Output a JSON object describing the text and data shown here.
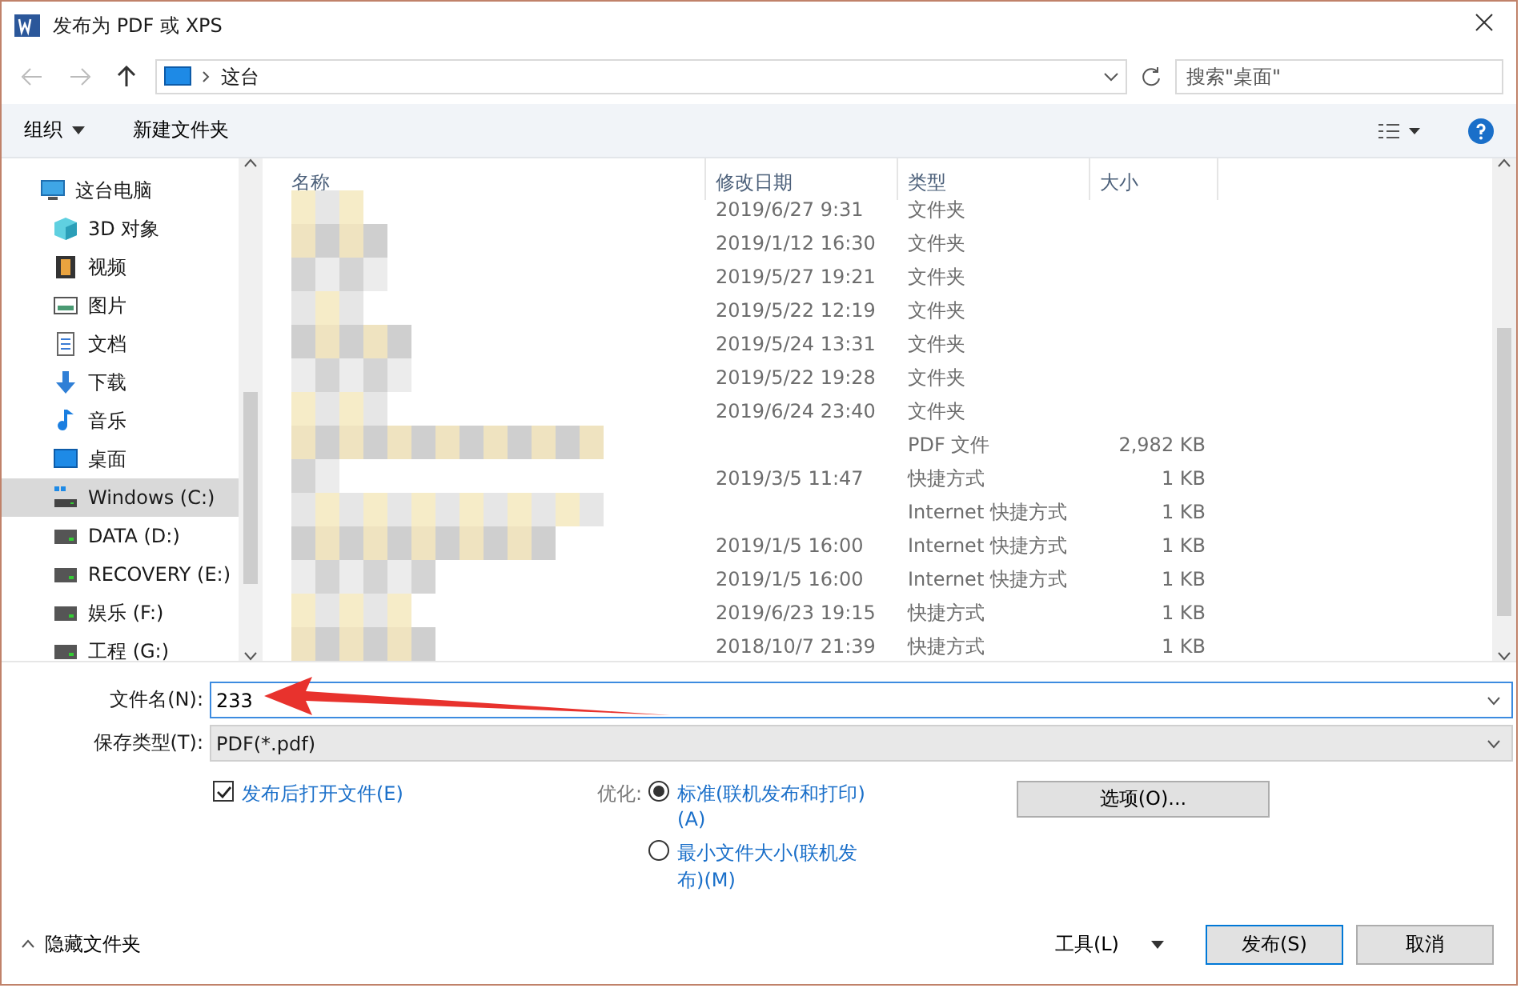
{
  "window": {
    "title": "发布为 PDF 或 XPS"
  },
  "address": {
    "crumbs": [
      "这台"
    ]
  },
  "search": {
    "placeholder": "搜索\"桌面\""
  },
  "toolbar": {
    "organize": "组织",
    "new_folder": "新建文件夹"
  },
  "sidebar": {
    "items": [
      {
        "label": "这台电脑",
        "kind": "pc",
        "selected": false,
        "children": [
          {
            "label": "3D 对象",
            "kind": "cube",
            "selected": false
          },
          {
            "label": "视频",
            "kind": "film",
            "selected": false
          },
          {
            "label": "图片",
            "kind": "image",
            "selected": false
          },
          {
            "label": "文档",
            "kind": "doc",
            "selected": false
          },
          {
            "label": "下载",
            "kind": "download",
            "selected": false
          },
          {
            "label": "音乐",
            "kind": "music",
            "selected": false
          },
          {
            "label": "桌面",
            "kind": "desktop",
            "selected": false
          },
          {
            "label": "Windows (C:)",
            "kind": "sysdrive",
            "selected": true
          },
          {
            "label": "DATA (D:)",
            "kind": "drive",
            "selected": false
          },
          {
            "label": "RECOVERY (E:)",
            "kind": "drive",
            "selected": false
          },
          {
            "label": "娱乐 (F:)",
            "kind": "drive",
            "selected": false
          },
          {
            "label": "工程 (G:)",
            "kind": "drive",
            "selected": false
          }
        ]
      }
    ]
  },
  "table": {
    "columns": [
      "名称",
      "修改日期",
      "类型",
      "大小"
    ],
    "rows": [
      {
        "date": "2019/6/27 9:31",
        "type": "文件夹"
      },
      {
        "date": "2019/1/12 16:30",
        "type": "文件夹"
      },
      {
        "date": "2019/5/27 19:21",
        "type": "文件夹"
      },
      {
        "date": "2019/5/22 12:19",
        "type": "文件夹"
      },
      {
        "date": "2019/5/24 13:31",
        "type": "文件夹"
      },
      {
        "date": "2019/5/22 19:28",
        "type": "文件夹"
      },
      {
        "date": "2019/6/24 23:40",
        "type": "文件夹"
      },
      {
        "type": "PDF 文件",
        "size": "2,982 KB"
      },
      {
        "date": "2019/3/5 11:47",
        "type": "快捷方式",
        "size": "1 KB"
      },
      {
        "type": "Internet 快捷方式",
        "size": "1 KB"
      },
      {
        "date": "2019/1/5 16:00",
        "type": "Internet 快捷方式",
        "size": "1 KB"
      },
      {
        "date": "2019/1/5 16:00",
        "type": "Internet 快捷方式",
        "size": "1 KB"
      },
      {
        "date": "2019/6/23 19:15",
        "type": "快捷方式",
        "size": "1 KB"
      },
      {
        "date": "2018/10/7 21:39",
        "type": "快捷方式",
        "size": "1 KB"
      }
    ]
  },
  "form": {
    "filename_label": "文件名(N):",
    "filename": "233",
    "filetype_label": "保存类型(T):",
    "filetype": "PDF(*.pdf)",
    "open_after": {
      "label": "发布后打开文件(E)",
      "checked": true
    },
    "optimize_label": "优化:",
    "optimize": [
      {
        "label": "标准(联机发布和打印)(A)",
        "selected": true
      },
      {
        "label": "最小文件大小(联机发布)(M)",
        "selected": false
      }
    ],
    "options_button": "选项(O)..."
  },
  "footer": {
    "hide_folders": "隐藏文件夹",
    "tools": "工具(L)",
    "publish": "发布(S)",
    "cancel": "取消"
  }
}
